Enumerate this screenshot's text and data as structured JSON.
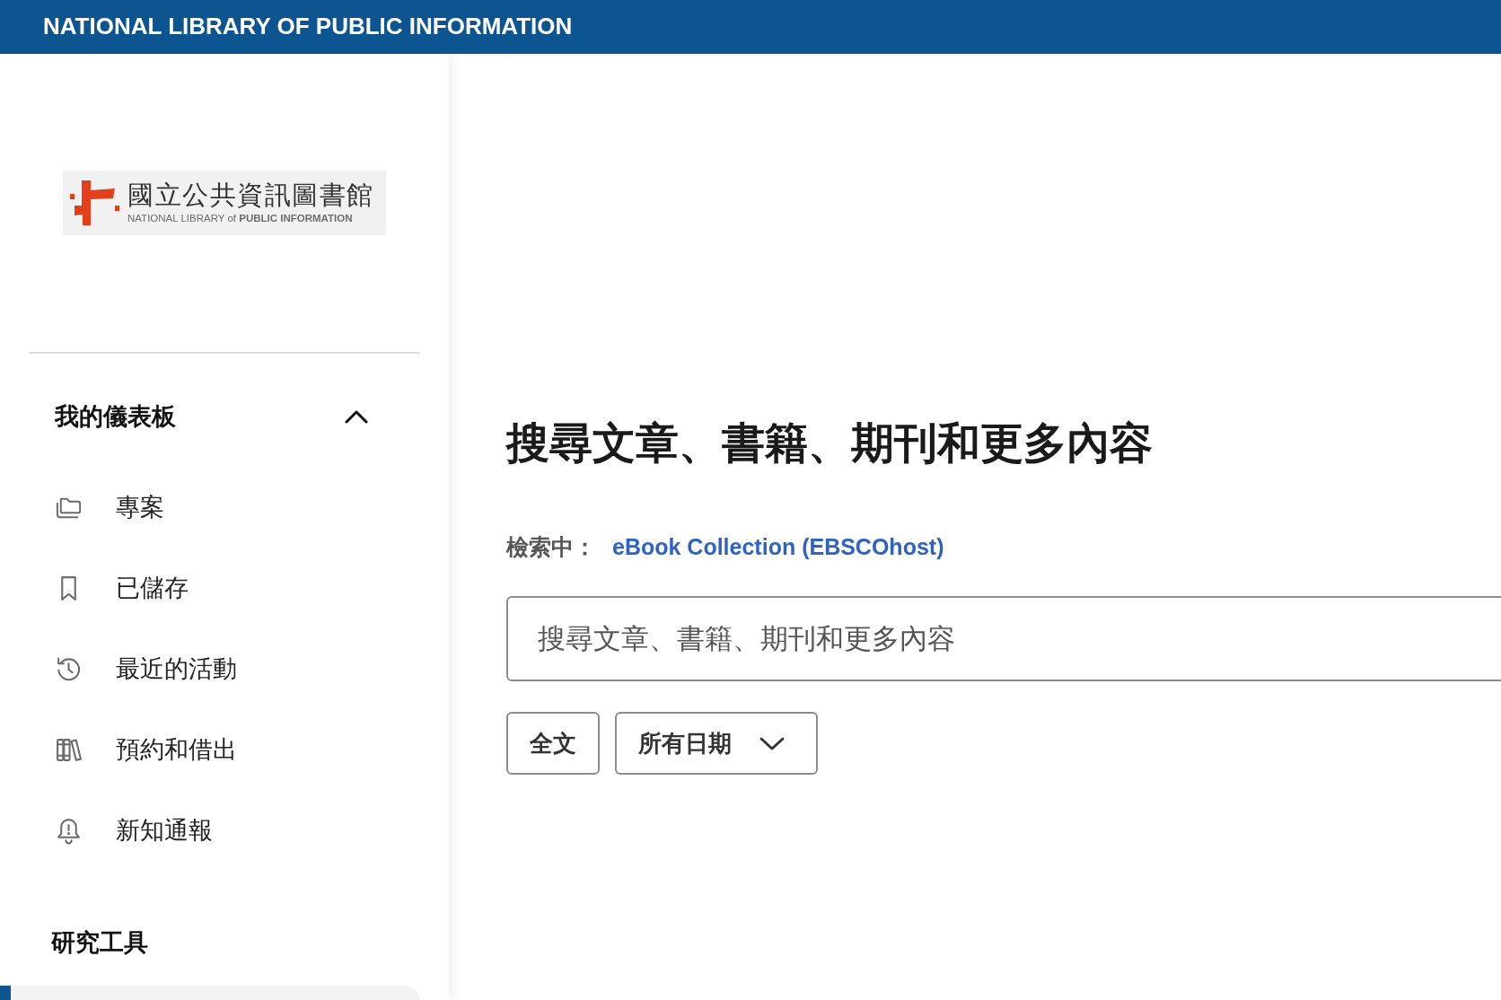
{
  "header": {
    "title": "NATIONAL LIBRARY OF PUBLIC INFORMATION"
  },
  "sidebar": {
    "logo": {
      "name": "國立公共資訊圖書館",
      "subtitle": "NATIONAL LIBRARY of **PUBLIC INFORMATION**"
    },
    "sections": [
      {
        "title": "我的儀表板",
        "expanded": true,
        "items": [
          {
            "label": "專案"
          },
          {
            "label": "已儲存"
          },
          {
            "label": "最近的活動"
          },
          {
            "label": "預約和借出"
          },
          {
            "label": "新知通報"
          }
        ]
      },
      {
        "title": "研究工具",
        "items": [
          {
            "selected": true
          }
        ]
      }
    ]
  },
  "main": {
    "heading": "搜尋文章、書籍、期刊和更多內容",
    "searching_in": {
      "label": "檢索中：",
      "database": "eBook Collection (EBSCOhost)"
    },
    "search": {
      "placeholder": "搜尋文章、書籍、期刊和更多內容"
    },
    "filters": [
      {
        "label": "全文",
        "kind": "button"
      },
      {
        "label": "所有日期",
        "kind": "dropdown"
      }
    ]
  }
}
